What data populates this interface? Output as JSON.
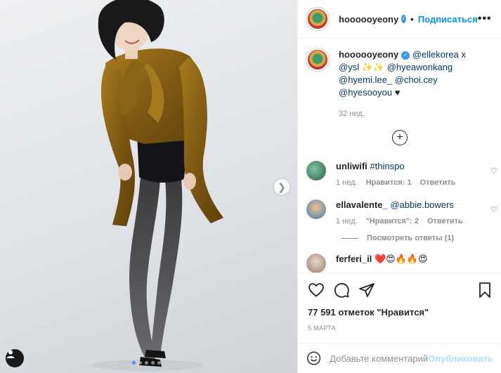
{
  "post": {
    "author": "hoooooyeony",
    "follow_label": "Подписаться",
    "more_label": "•••"
  },
  "caption": {
    "username": "hoooooyeony",
    "text_parts": [
      "@ellekorea",
      "x",
      "@ysl",
      "✨✨",
      "@hyeawonkang",
      "@hyemi.lee_",
      "@choi.cey",
      "@hyesooyou",
      "♥"
    ],
    "time": "32 нед."
  },
  "comments": [
    {
      "username": "unliwifi",
      "text": "#thinspo",
      "time": "1 нед.",
      "likes": "Нравится: 1",
      "reply": "Ответить"
    },
    {
      "username": "ellavalente_",
      "text": "@abbie.bowers",
      "time": "1 нед.",
      "likes": "\"Нравится\": 2",
      "reply": "Ответить",
      "view_replies": "Посмотреть ответы (1)"
    },
    {
      "username": "ferferi_il",
      "text": "❤️😍🔥🔥😍"
    }
  ],
  "actions": {
    "likes_count": "77 591 отметок \"Нравится\"",
    "date": "5 МАРТА"
  },
  "add_comment": {
    "placeholder": "Добавьте комментарий...",
    "publish_label": "Опубликовать"
  },
  "icons": {
    "like": "heart-icon",
    "comment": "comment-icon",
    "share": "share-icon",
    "save": "bookmark-icon",
    "emoji": "emoji-icon",
    "next": "chevron-right-icon",
    "tag": "user-tag-icon",
    "load_more": "plus-circle-icon"
  },
  "colors": {
    "accent": "#0095f6",
    "mention": "#00376b",
    "muted": "#8e8e8e",
    "publish_disabled": "#b2dffc"
  },
  "carousel": {
    "slides": 5,
    "active": 1
  }
}
